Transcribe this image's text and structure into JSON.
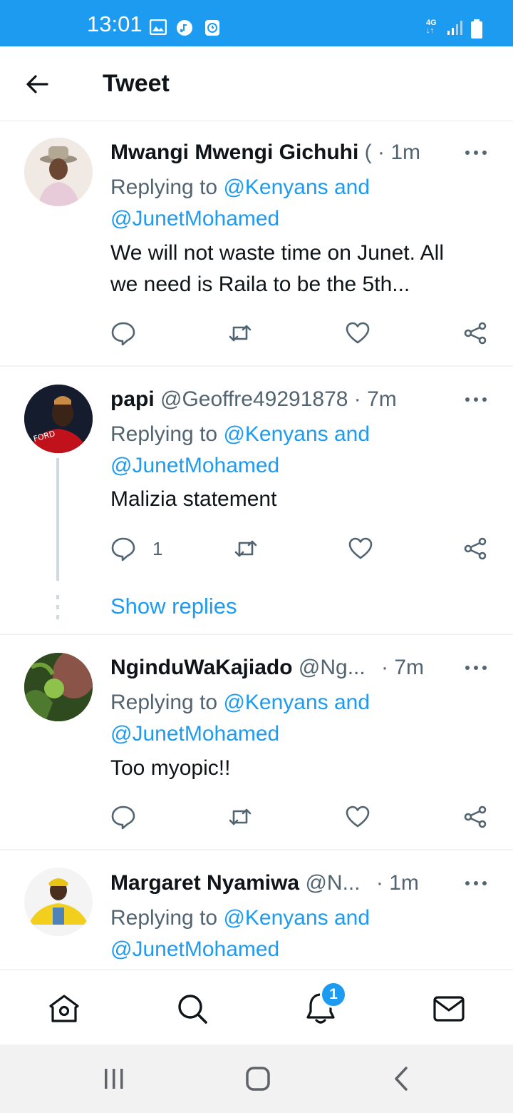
{
  "status_bar": {
    "time": "13:01",
    "network": "4G",
    "icons": [
      "gallery-icon",
      "music-icon",
      "clock-icon",
      "signal-icon",
      "battery-icon"
    ],
    "background": "#1d9bf0"
  },
  "header": {
    "title": "Tweet",
    "back_icon": "arrow-left-icon"
  },
  "tweets": [
    {
      "name": "Mwangi Mwengi Gichuhi",
      "handle": "(",
      "time": "· 1m",
      "replying_prefix": "Replying to",
      "replying_to_1": "@Kenyans and",
      "replying_to_2": "@JunetMohamed",
      "text_line_1": "We will not waste time on Junet. All",
      "text_line_2": "we need is Raila to be the 5th..."
    },
    {
      "name": "papi",
      "handle": "@Geoffre49291878",
      "time": "· 7m",
      "replying_prefix": "Replying to",
      "replying_to_1": "@Kenyans and",
      "replying_to_2": "@JunetMohamed",
      "text_line_1": "Malizia statement",
      "reply_count": "1",
      "show_replies": "Show replies"
    },
    {
      "name": "NginduWaKajiado",
      "handle": "@Ng...",
      "time": "· 7m",
      "replying_prefix": "Replying to",
      "replying_to_1": "@Kenyans and",
      "replying_to_2": "@JunetMohamed",
      "text_line_1": "Too myopic!!"
    },
    {
      "name": "Margaret Nyamiwa",
      "handle": "@N...",
      "time": "· 1m",
      "replying_prefix": "Replying to",
      "replying_to_1": "@Kenyans and",
      "replying_to_2": "@JunetMohamed"
    }
  ],
  "tab_bar": {
    "tabs": [
      "home-icon",
      "search-icon",
      "notifications-icon",
      "messages-icon"
    ],
    "notification_badge": "1"
  },
  "system_nav": [
    "recents-icon",
    "home-icon",
    "back-icon"
  ],
  "colors": {
    "accent": "#1d9bf0",
    "text": "#0f1419",
    "muted": "#536471",
    "divider": "#eff3f4"
  }
}
